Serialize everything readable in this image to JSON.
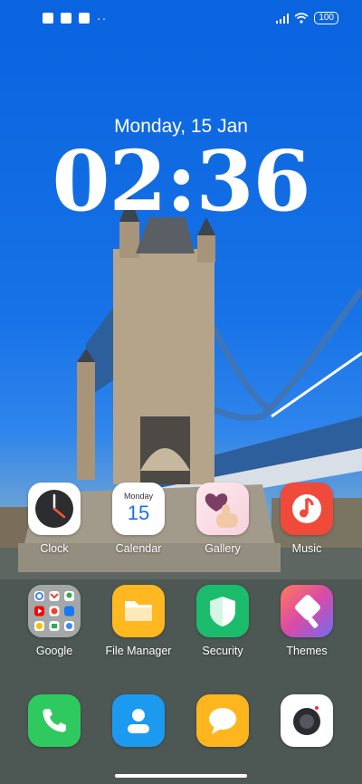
{
  "status_bar": {
    "left_icons": [
      "notification-app-icon",
      "notification-square-icon",
      "notification-upload-icon"
    ],
    "overflow": "··",
    "battery": "100"
  },
  "lock": {
    "date": "Monday, 15 Jan",
    "time": "02:36"
  },
  "apps": {
    "clock": "Clock",
    "calendar": "Calendar",
    "calendar_day": "Monday",
    "calendar_date": "15",
    "gallery": "Gallery",
    "music": "Music",
    "google": "Google",
    "file_manager": "File Manager",
    "security": "Security",
    "themes": "Themes"
  },
  "dock": [
    "phone",
    "contacts",
    "messages",
    "camera"
  ],
  "colors": {
    "sky": "#1672e6",
    "phone": "#2fca5f",
    "contacts": "#1b9af0",
    "messages": "#ffb51d",
    "music": "#ef4a3a",
    "security": "#1bbc6b",
    "file_manager": "#ffb81f"
  }
}
